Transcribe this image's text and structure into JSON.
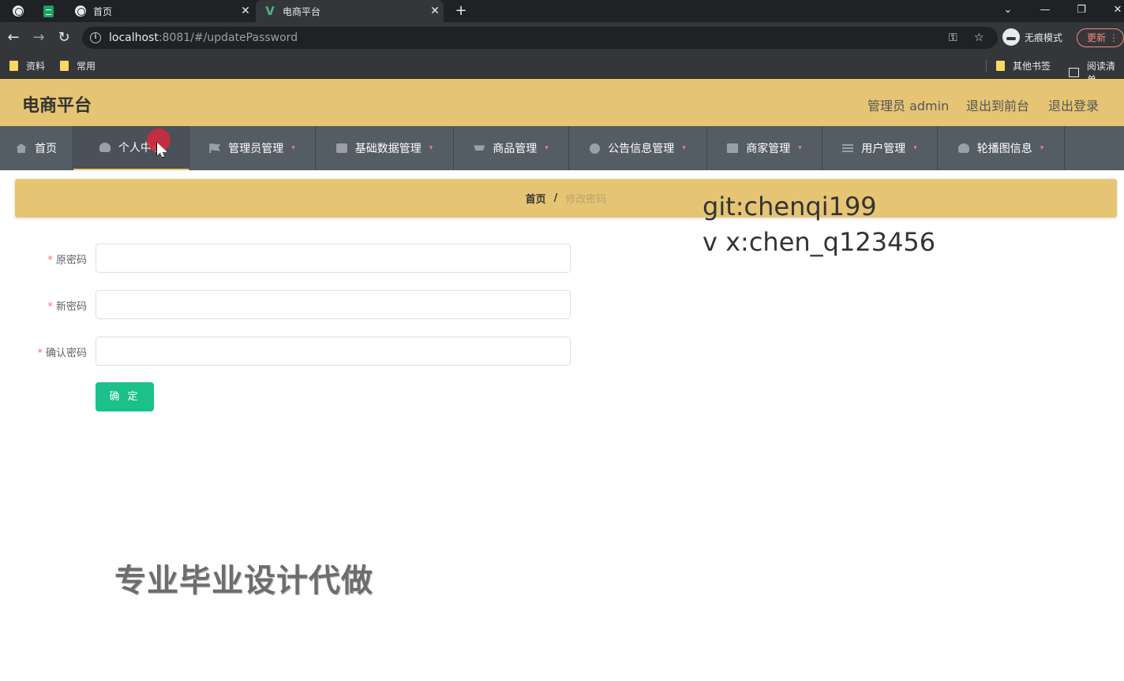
{
  "browser": {
    "tabs": [
      {
        "title": "首页",
        "active": false
      },
      {
        "title": "电商平台",
        "active": true
      }
    ],
    "url_host": "localhost",
    "url_rest": ":8081/#/updatePassword",
    "incognito_label": "无痕模式",
    "update_label": "更新",
    "bookmarks": [
      "资料",
      "常用"
    ],
    "bookmarks_right": [
      "其他书签",
      "阅读清单"
    ]
  },
  "header": {
    "brand": "电商平台",
    "links": [
      "管理员 admin",
      "退出到前台",
      "退出登录"
    ]
  },
  "menu": {
    "items": [
      {
        "label": "首页",
        "icon": "home-icon"
      },
      {
        "label": "个人中心",
        "icon": "user-icon",
        "active": true
      },
      {
        "label": "管理员管理",
        "icon": "flag-icon"
      },
      {
        "label": "基础数据管理",
        "icon": "film-icon"
      },
      {
        "label": "商品管理",
        "icon": "cart-icon"
      },
      {
        "label": "公告信息管理",
        "icon": "compass-icon"
      },
      {
        "label": "商家管理",
        "icon": "book-icon"
      },
      {
        "label": "用户管理",
        "icon": "list-icon"
      },
      {
        "label": "轮播图信息",
        "icon": "user-icon"
      }
    ]
  },
  "breadcrumb": {
    "home": "首页",
    "separator": "/",
    "current": "修改密码"
  },
  "form": {
    "fields": [
      {
        "label": "原密码",
        "value": ""
      },
      {
        "label": "新密码",
        "value": ""
      },
      {
        "label": "确认密码",
        "value": ""
      }
    ],
    "submit_label": "确 定"
  },
  "overlay": {
    "watermark_lines": [
      "git:chenqi199",
      "v x:chen_q123456"
    ],
    "promo": "专业毕业设计代做"
  },
  "colors": {
    "header_bg": "#e5c573",
    "menu_bg": "#545c64",
    "submit_bg": "#1bc08a"
  }
}
